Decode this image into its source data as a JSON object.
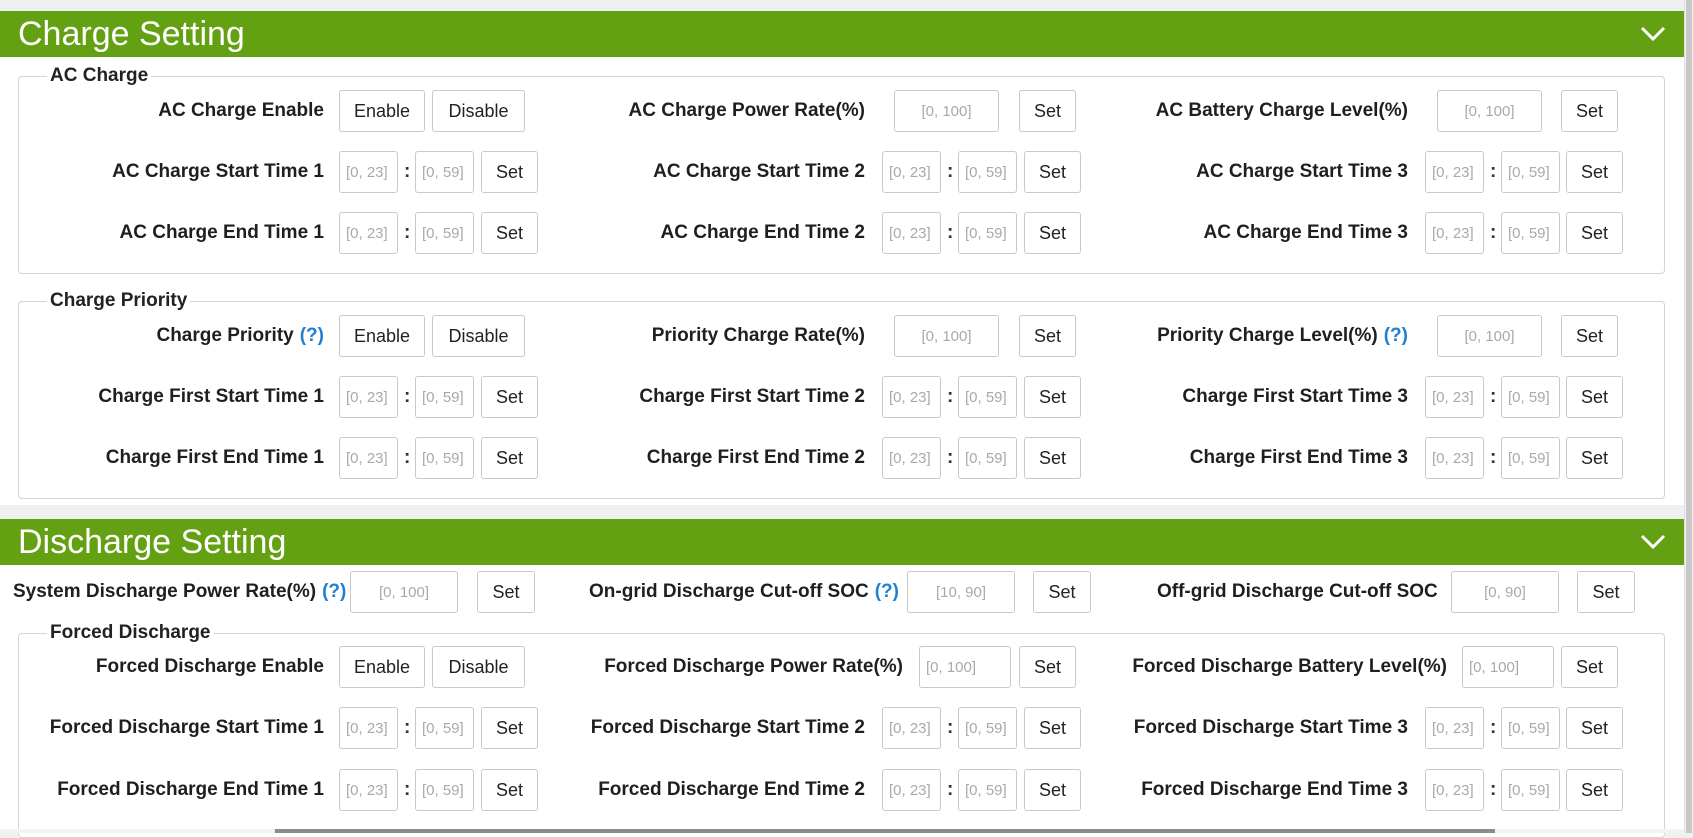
{
  "charge": {
    "title": "Charge Setting",
    "ac": {
      "legend": "AC Charge",
      "enable_label": "AC Charge Enable",
      "enable": "Enable",
      "disable": "Disable",
      "power_rate_label": "AC Charge Power Rate(%)",
      "power_rate_ph": "[0, 100]",
      "battery_level_label": "AC Battery Charge Level(%)",
      "battery_level_ph": "[0, 100]",
      "start_labels": [
        "AC Charge Start Time 1",
        "AC Charge Start Time 2",
        "AC Charge Start Time 3"
      ],
      "end_labels": [
        "AC Charge End Time 1",
        "AC Charge End Time 2",
        "AC Charge End Time 3"
      ]
    },
    "priority": {
      "legend": "Charge Priority",
      "enable_label": "Charge Priority",
      "help": "(?)",
      "enable": "Enable",
      "disable": "Disable",
      "rate_label": "Priority Charge Rate(%)",
      "rate_ph": "[0, 100]",
      "level_label": "Priority Charge Level(%)",
      "level_ph": "[0, 100]",
      "start_labels": [
        "Charge First Start Time 1",
        "Charge First Start Time 2",
        "Charge First Start Time 3"
      ],
      "end_labels": [
        "Charge First End Time 1",
        "Charge First End Time 2",
        "Charge First End Time 3"
      ]
    }
  },
  "discharge": {
    "title": "Discharge Setting",
    "system_rate_label": "System Discharge Power Rate(%)",
    "system_rate_ph": "[0, 100]",
    "ongrid_label": "On-grid Discharge Cut-off SOC",
    "ongrid_ph": "[10, 90]",
    "offgrid_label": "Off-grid Discharge Cut-off SOC",
    "offgrid_ph": "[0, 90]",
    "help": "(?)",
    "forced": {
      "legend": "Forced Discharge",
      "enable_label": "Forced Discharge Enable",
      "enable": "Enable",
      "disable": "Disable",
      "power_rate_label": "Forced Discharge Power Rate(%)",
      "power_rate_ph": "[0, 100]",
      "battery_level_label": "Forced Discharge Battery Level(%)",
      "battery_level_ph": "[0, 100]",
      "start_labels": [
        "Forced Discharge Start Time 1",
        "Forced Discharge Start Time 2",
        "Forced Discharge Start Time 3"
      ],
      "end_labels": [
        "Forced Discharge End Time 1",
        "Forced Discharge End Time 2",
        "Forced Discharge End Time 3"
      ]
    }
  },
  "common": {
    "set": "Set",
    "colon": ":",
    "hour_ph": "[0, 23]",
    "minute_ph": "[0, 59]"
  }
}
